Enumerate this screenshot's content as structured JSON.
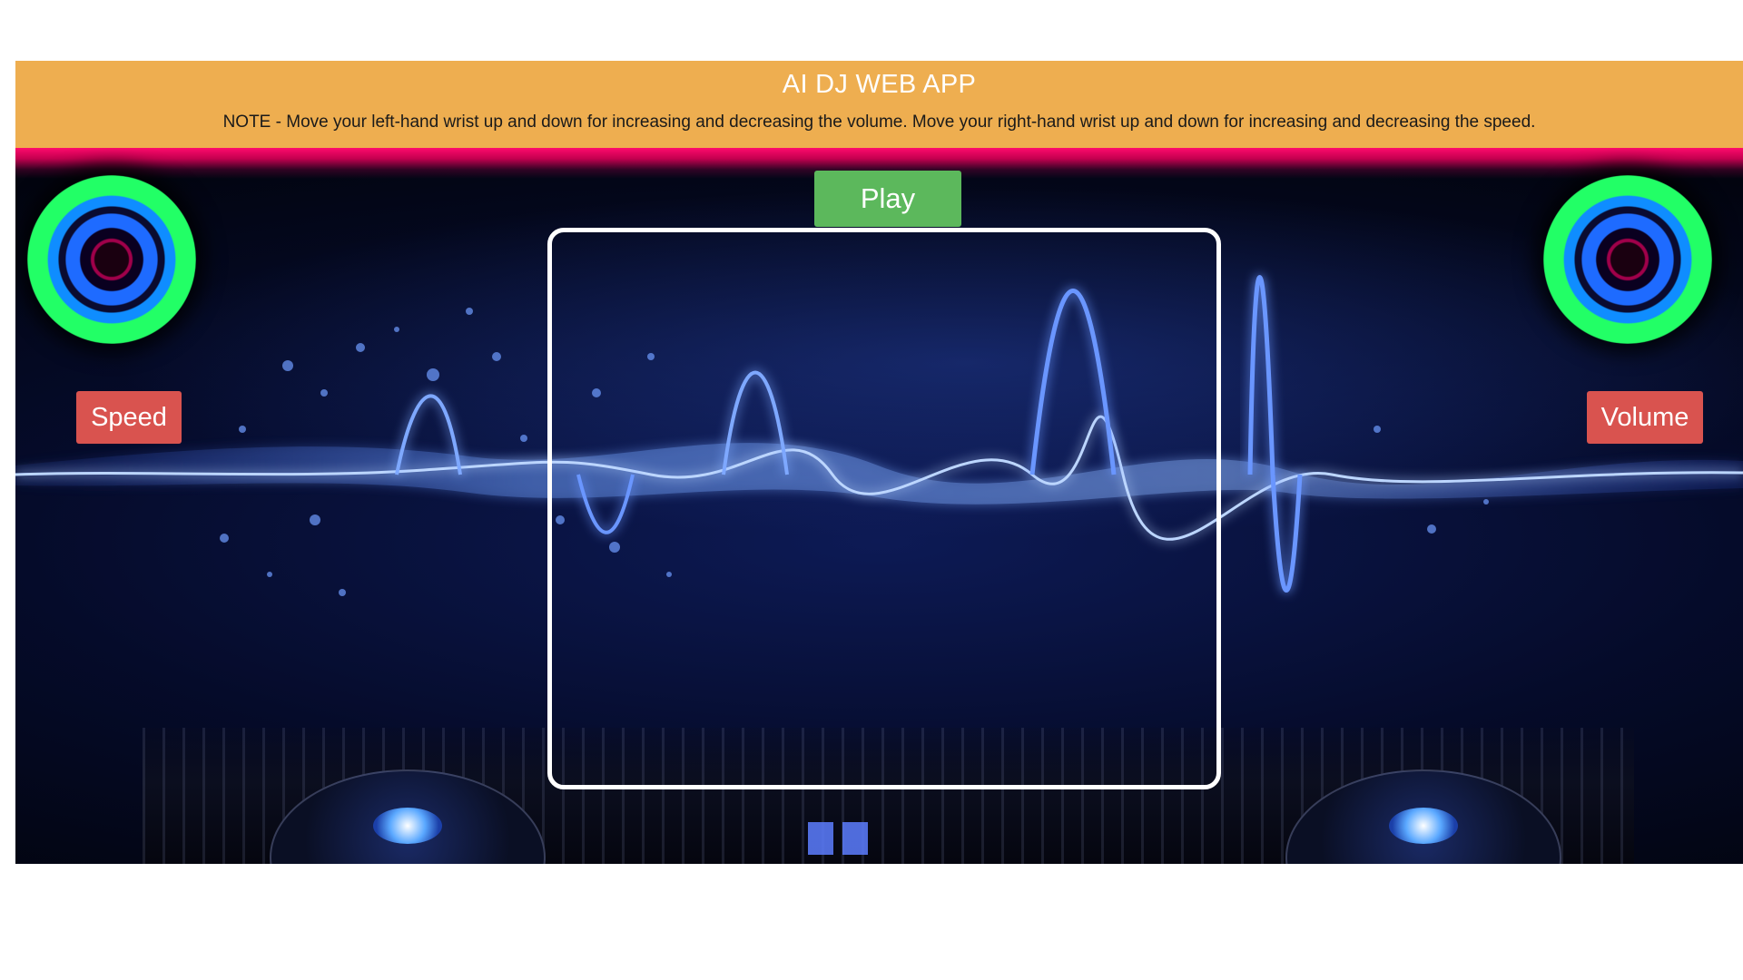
{
  "header": {
    "title": "AI DJ WEB APP",
    "note": "NOTE - Move your left-hand wrist up and down for increasing and decreasing the volume. Move your right-hand wrist up and down for increasing and decreasing the speed."
  },
  "controls": {
    "play_label": "Play",
    "speed_label": "Speed",
    "volume_label": "Volume"
  },
  "colors": {
    "header_bg": "#eeae50",
    "play_button": "#5cb85c",
    "speed_volume_buttons": "#d9534f",
    "pink_glow": "#ff0a6c"
  },
  "icons": {
    "left_orb": "speaker-glow-icon",
    "right_orb": "speaker-glow-icon"
  }
}
